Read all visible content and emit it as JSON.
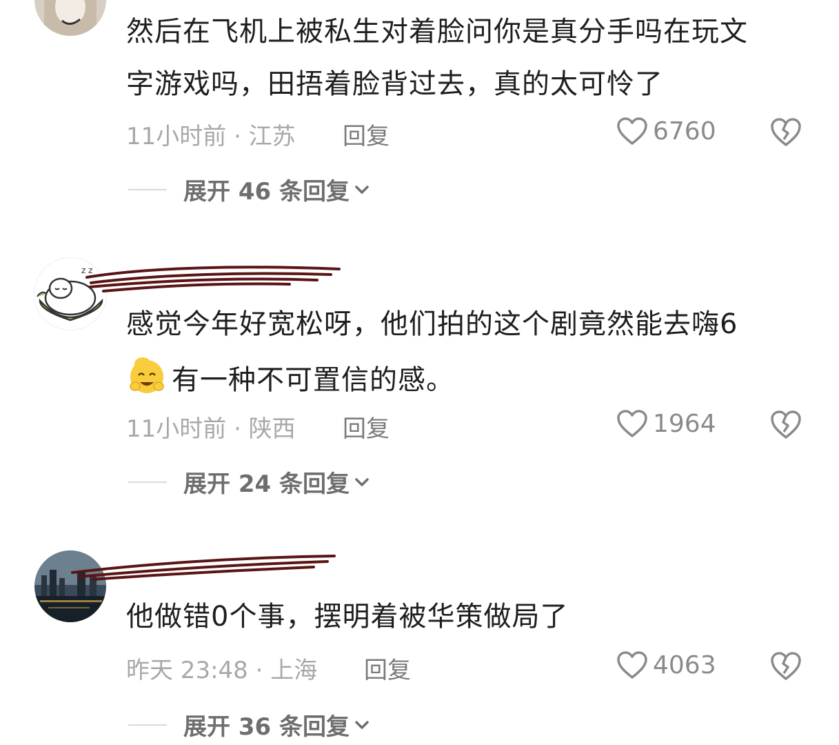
{
  "comments": [
    {
      "lines": [
        "然后在飞机上被私生对着脸问你是真分手吗在玩文",
        "字游戏吗，田捂着脸背过去，真的太可怜了"
      ],
      "meta": "11小时前 · 江苏",
      "reply": "回复",
      "likes": "6760",
      "expand": "展开 46 条回复"
    },
    {
      "lines": [
        "感觉今年好宽松呀，他们拍的这个剧竟然能去嗨6",
        "有一种不可置信的感。"
      ],
      "meta": "11小时前 · 陕西",
      "reply": "回复",
      "likes": "1964",
      "expand": "展开 24 条回复"
    },
    {
      "lines": [
        "他做错0个事，摆明着被华策做局了"
      ],
      "meta": "昨天 23:48 · 上海",
      "reply": "回复",
      "likes": "4063",
      "expand": "展开 36 条回复"
    }
  ],
  "icons": {
    "like": "heart-outline-icon",
    "dislike": "broken-heart-icon",
    "expand": "chevron-down-icon"
  },
  "colors": {
    "text": "#1e1e1e",
    "meta": "#a8a8a8",
    "icon": "#8a8a8a",
    "redaction": "#5a1414"
  }
}
